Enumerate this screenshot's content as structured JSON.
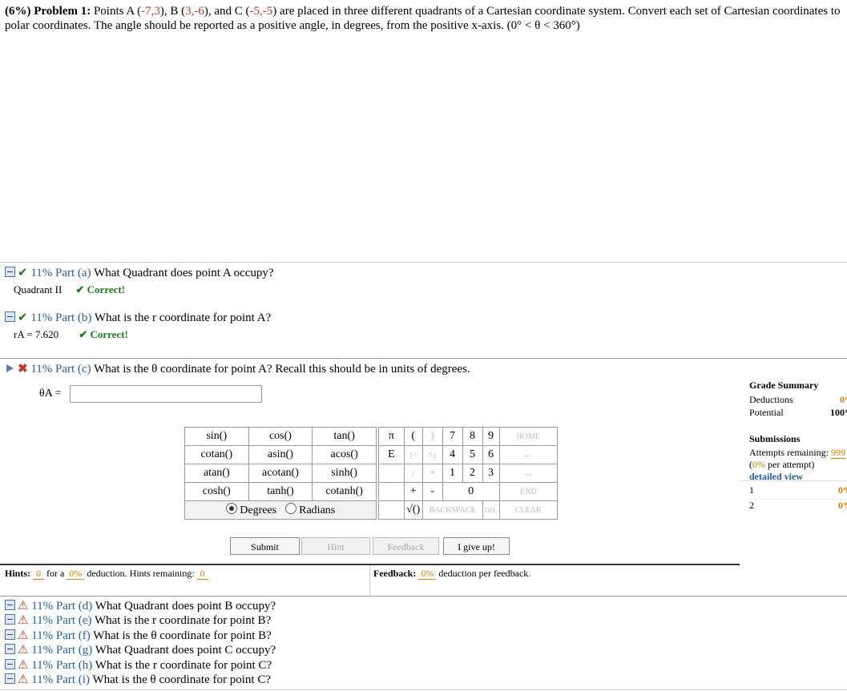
{
  "problem": {
    "label": "(6%)  Problem 1:",
    "t1": "Points A (",
    "a": "-7,3",
    "t2": "), B (",
    "b": "3,-6",
    "t3": "), and C (",
    "c": "-5,-5",
    "t4": ") are placed in three different quadrants of a Cartesian coordinate system. Convert each set of Cartesian coordinates to polar coordinates. The angle should be reported as a positive angle, in degrees, from the positive x-axis. (0° < θ < 360°)"
  },
  "parts_done": [
    {
      "pct": "11% Part (a)",
      "q": "What Quadrant does point A occupy?",
      "answer": "Quadrant II",
      "status": "✔ Correct!"
    },
    {
      "pct": "11% Part (b)",
      "q": "What is the r coordinate for point A?",
      "answer": "rA = 7.620",
      "status": "✔ Correct!"
    }
  ],
  "current": {
    "pct": "11% Part (c)",
    "q": "What is the θ coordinate for point A? Recall this should be in units of degrees.",
    "input_label": "θA =",
    "input_value": ""
  },
  "calculator": {
    "funcs": [
      [
        "sin()",
        "cos()",
        "tan()"
      ],
      [
        "cotan()",
        "asin()",
        "acos()"
      ],
      [
        "atan()",
        "acotan()",
        "sinh()"
      ],
      [
        "cosh()",
        "tanh()",
        "cotanh()"
      ]
    ],
    "mode_degrees": "Degrees",
    "mode_radians": "Radians",
    "keys_row1": [
      "π",
      "(",
      ")",
      "7",
      "8",
      "9",
      "HOME"
    ],
    "keys_row2": [
      "E",
      "↑^",
      "^↓",
      "4",
      "5",
      "6",
      "←"
    ],
    "keys_row3": [
      "",
      "/",
      "*",
      "1",
      "2",
      "3",
      "→"
    ],
    "keys_row4": [
      "",
      "+",
      "-",
      "",
      "0",
      ".",
      "END"
    ],
    "keys_row5": [
      "",
      "√()",
      "BACKSPACE",
      "DEL",
      "CLEAR"
    ]
  },
  "buttons": {
    "submit": "Submit",
    "hint": "Hint",
    "feedback": "Feedback",
    "give_up": "I give up!"
  },
  "hints": {
    "label": "Hints:",
    "count": "0",
    "mid": "for a",
    "pct": "0%",
    "tail": "deduction. Hints remaining:",
    "remaining": "0"
  },
  "feedback": {
    "label": "Feedback:",
    "pct": "0%",
    "tail": "deduction per feedback."
  },
  "grade": {
    "title": "Grade Summary",
    "deductions_label": "Deductions",
    "deductions_value": "0%",
    "potential_label": "Potential",
    "potential_value": "100%",
    "submissions_title": "Submissions",
    "attempts_label": "Attempts remaining:",
    "attempts_value": "999",
    "per_attempt_pct": "0%",
    "per_attempt_text": "per attempt",
    "detailed": "detailed view",
    "rows": [
      {
        "n": "1",
        "v": "0%"
      },
      {
        "n": "2",
        "v": "0%"
      }
    ]
  },
  "parts_todo": [
    {
      "pct": "11% Part (d)",
      "q": "What Quadrant does point B occupy?"
    },
    {
      "pct": "11% Part (e)",
      "q": "What is the r coordinate for point B?"
    },
    {
      "pct": "11% Part (f)",
      "q": "What is the θ coordinate for point B?"
    },
    {
      "pct": "11% Part (g)",
      "q": "What Quadrant does point C occupy?"
    },
    {
      "pct": "11% Part (h)",
      "q": "What is the r coordinate for point C?"
    },
    {
      "pct": "11% Part (i)",
      "q": "What is the θ coordinate for point C?"
    }
  ]
}
